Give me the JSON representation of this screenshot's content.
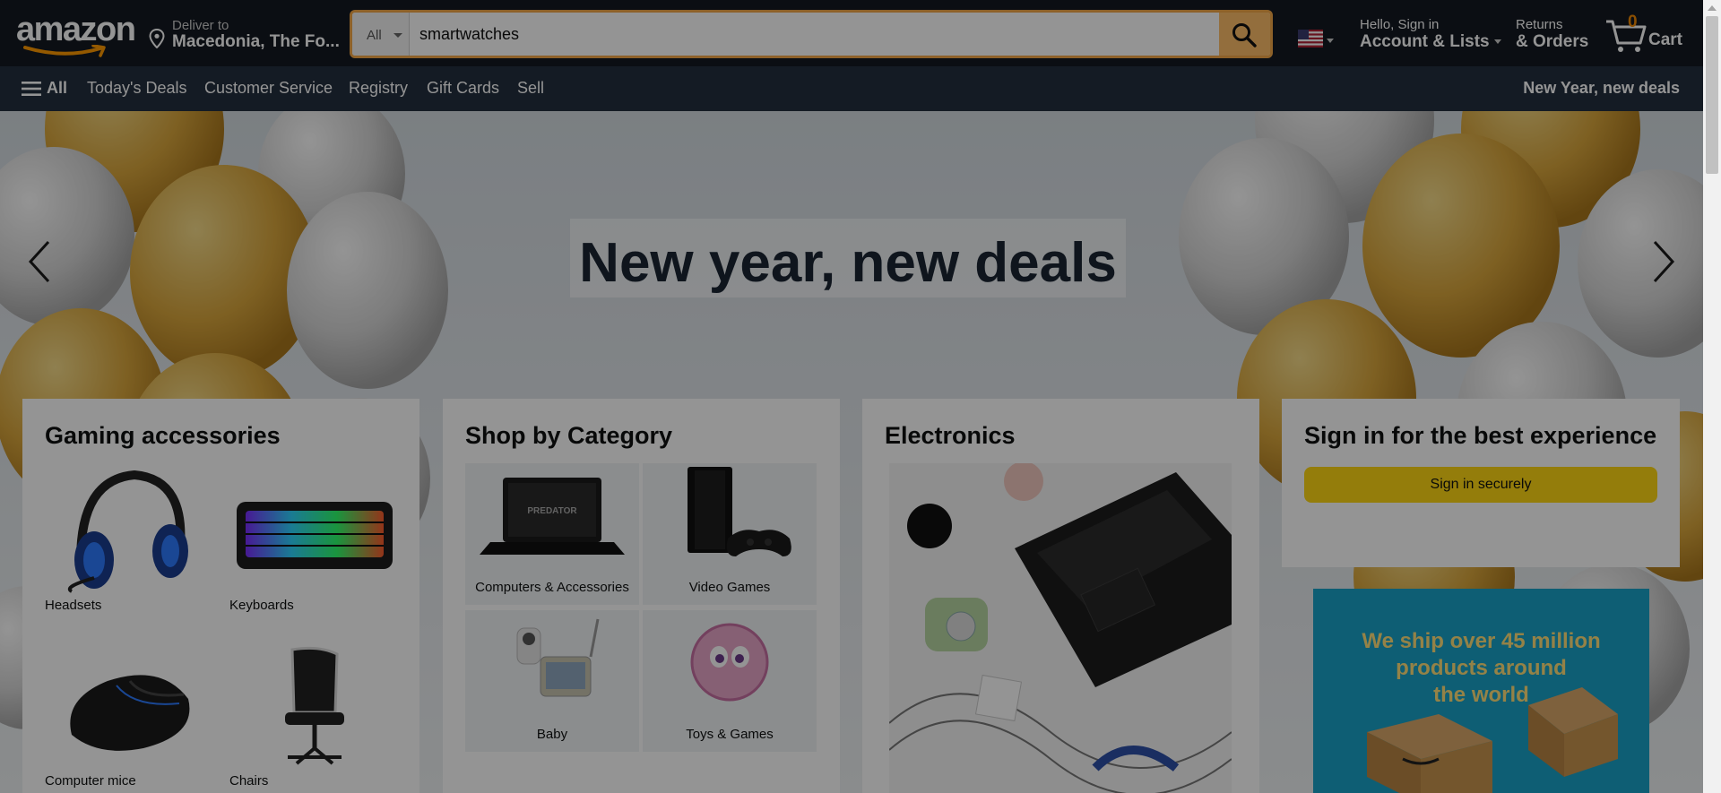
{
  "header": {
    "logo_text": "amazon",
    "deliver_line1": "Deliver to",
    "deliver_line2": "Macedonia, The Fo...",
    "search_category": "All",
    "search_value": "smartwatches",
    "account_line1": "Hello, Sign in",
    "account_line2": "Account & Lists",
    "returns_line1": "Returns",
    "returns_line2": "& Orders",
    "cart_count": "0",
    "cart_label": "Cart"
  },
  "subnav": {
    "all_label": "All",
    "items": [
      "Today's Deals",
      "Customer Service",
      "Registry",
      "Gift Cards",
      "Sell"
    ],
    "promo": "New Year, new deals"
  },
  "hero": {
    "title": "New year, new deals"
  },
  "cards": {
    "gaming": {
      "title": "Gaming accessories",
      "items": [
        "Headsets",
        "Keyboards",
        "Computer mice",
        "Chairs"
      ]
    },
    "category": {
      "title": "Shop by Category",
      "items": [
        "Computers & Accessories",
        "Video Games",
        "Baby",
        "Toys & Games"
      ]
    },
    "electronics": {
      "title": "Electronics"
    },
    "signin": {
      "title": "Sign in for the best experience",
      "button": "Sign in securely"
    },
    "ship_ad": {
      "lines": [
        "We ship over 45 million",
        "products around",
        "the world"
      ]
    }
  },
  "colors": {
    "nav_bg": "#131921",
    "subnav_bg": "#232f3e",
    "search_button": "#febd69",
    "search_focus": "#f3a847",
    "cart_count": "#f08804",
    "signin_button": "#ffd814",
    "ship_ad_bg": "#19a2c8"
  },
  "icons": [
    "location-pin-icon",
    "search-icon",
    "us-flag-icon",
    "cart-icon",
    "hamburger-icon",
    "chevron-left-icon",
    "chevron-right-icon"
  ]
}
